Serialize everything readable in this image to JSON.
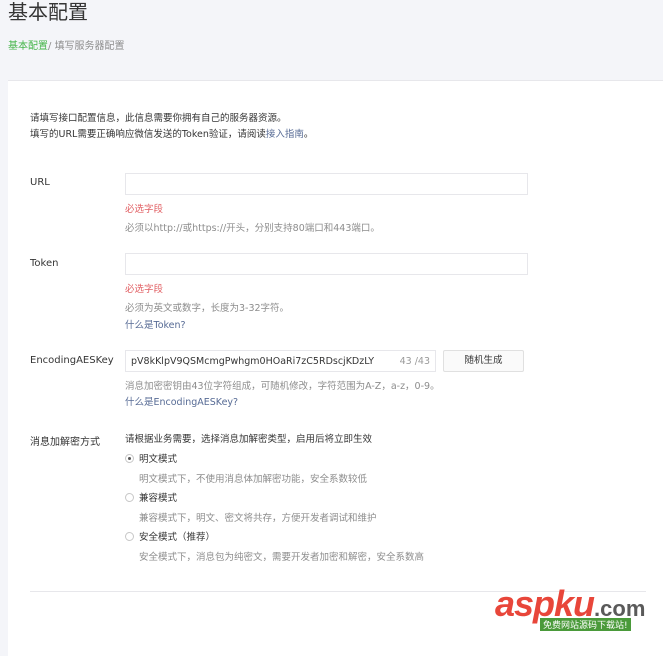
{
  "header": {
    "title": "基本配置",
    "breadcrumb_active": "基本配置",
    "breadcrumb_sep": "/ ",
    "breadcrumb_current": "填写服务器配置"
  },
  "intro": {
    "line1": "请填写接口配置信息，此信息需要你拥有自己的服务器资源。",
    "line2_prefix": "填写的URL需要正确响应微信发送的Token验证，请阅读",
    "line2_link": "接入指南",
    "line2_suffix": "。"
  },
  "url": {
    "label": "URL",
    "value": "",
    "error": "必选字段",
    "tip": "必须以http://或https://开头，分别支持80端口和443端口。"
  },
  "token": {
    "label": "Token",
    "value": "",
    "error": "必选字段",
    "tip": "必须为英文或数字，长度为3-32字符。",
    "help_link": "什么是Token?"
  },
  "aes": {
    "label": "EncodingAESKey",
    "value": "pV8kKlpV9QSMcmgPwhgm0HOaRi7zC5RDscjKDzLY",
    "count": "43 /43",
    "generate_button": "随机生成",
    "tip": "消息加密密钥由43位字符组成，可随机修改，字符范围为A-Z，a-z，0-9。",
    "help_link": "什么是EncodingAESKey?"
  },
  "encrypt": {
    "label": "消息加解密方式",
    "header": "请根据业务需要，选择消息加解密类型，启用后将立即生效",
    "selected": "plain",
    "options": [
      {
        "label": "明文模式",
        "desc": "明文模式下，不使用消息体加解密功能，安全系数较低"
      },
      {
        "label": "兼容模式",
        "desc": "兼容模式下，明文、密文将共存，方便开发者调试和维护"
      },
      {
        "label": "安全模式（推荐）",
        "desc": "安全模式下，消息包为纯密文，需要开发者加密和解密，安全系数高"
      }
    ]
  },
  "watermark": {
    "main": "aspku",
    "suffix": ".com",
    "sub": "免费网站源码下载站!"
  },
  "colors": {
    "accent_green": "#44b549",
    "error_red": "#e15f63",
    "link_blue": "#576b95",
    "watermark_red": "#e8463a"
  }
}
